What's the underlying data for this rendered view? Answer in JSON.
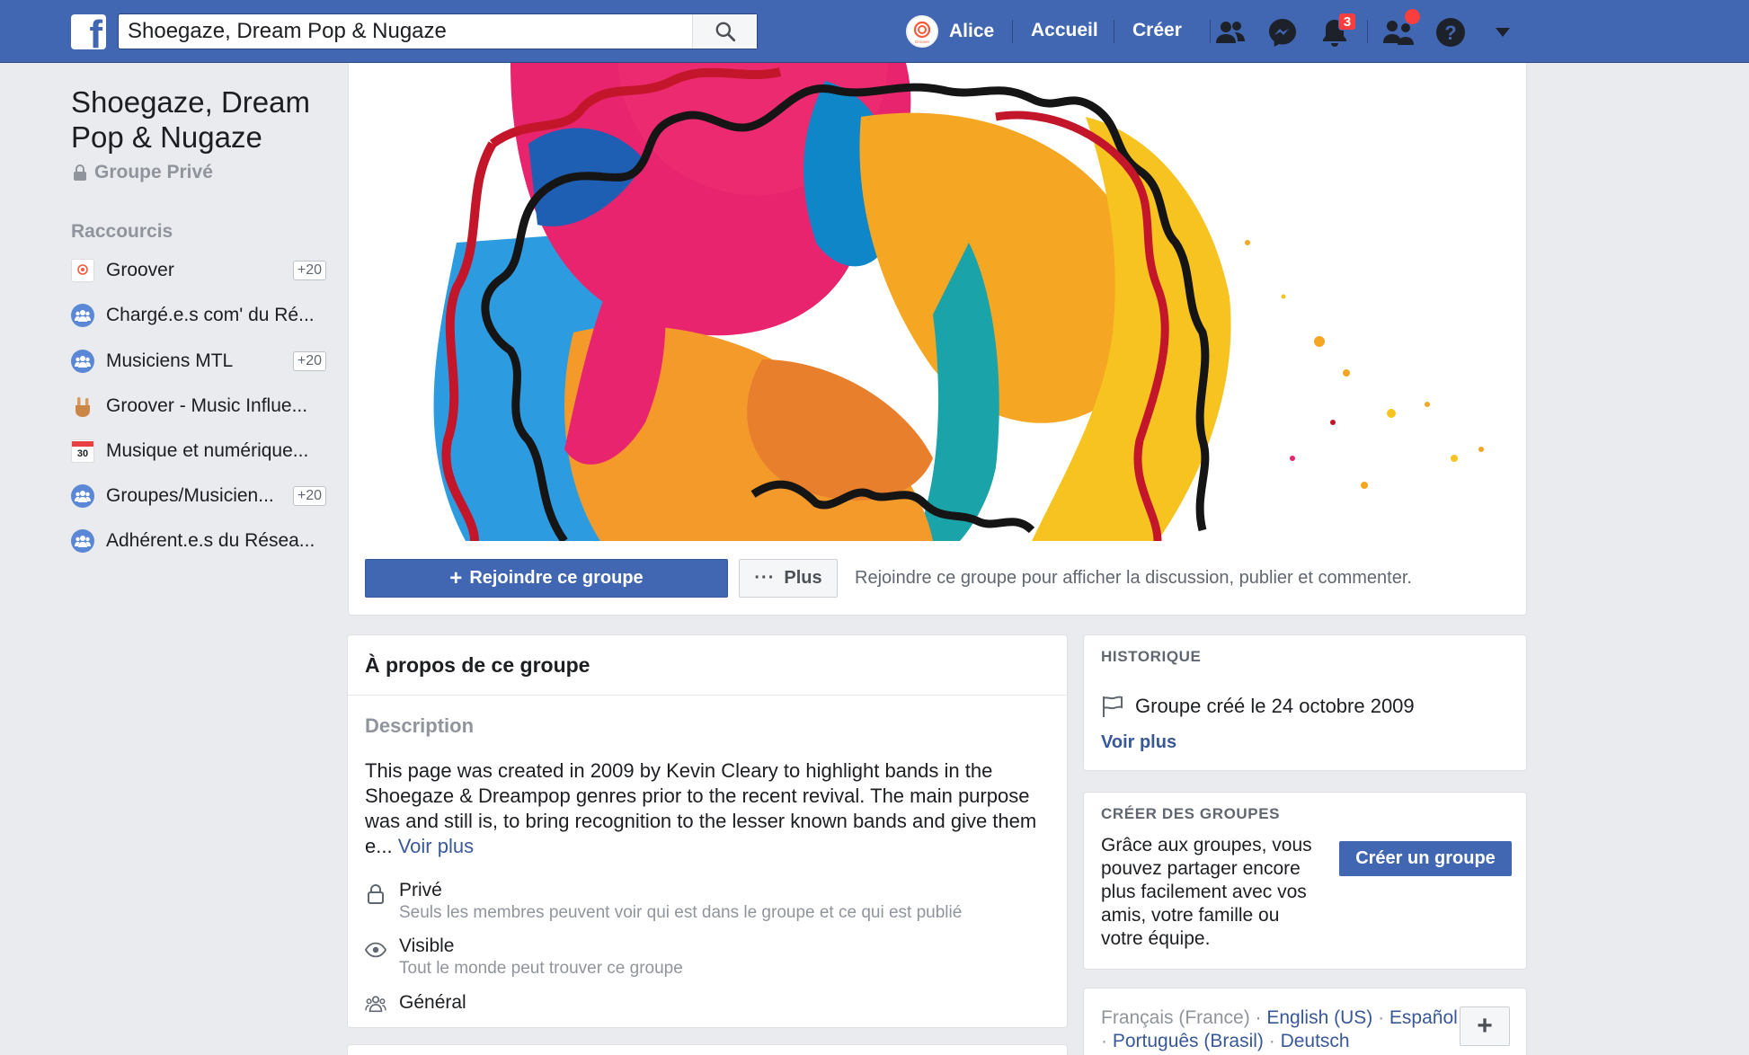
{
  "topbar": {
    "logo": "f",
    "search_value": "Shoegaze, Dream Pop & Nugaze",
    "profile_name": "Alice",
    "avatar_text": "Groover",
    "home_label": "Accueil",
    "create_label": "Créer",
    "notifications_count": "3",
    "icons": [
      "search-icon",
      "friends-icon",
      "messenger-icon",
      "notifications-icon",
      "friend-requests-icon",
      "help-icon",
      "caret-down-icon"
    ]
  },
  "group": {
    "title": "Shoegaze, Dream Pop & Nugaze",
    "privacy": "Groupe Privé"
  },
  "shortcuts": {
    "title": "Raccourcis",
    "items": [
      {
        "label": "Groover",
        "count": "+20",
        "icon": "groover-icon"
      },
      {
        "label": "Chargé.e.s com' du Ré...",
        "count": "",
        "icon": "group-icon"
      },
      {
        "label": "Musiciens MTL",
        "count": "+20",
        "icon": "group-icon"
      },
      {
        "label": "Groover - Music Influe...",
        "count": "",
        "icon": "rock-hand-icon"
      },
      {
        "label": "Musique et numérique...",
        "count": "",
        "icon": "calendar-icon"
      },
      {
        "label": "Groupes/Musicien...",
        "count": "+20",
        "icon": "group-icon"
      },
      {
        "label": "Adhérent.e.s du Résea...",
        "count": "",
        "icon": "group-icon"
      }
    ],
    "calendar_day": "30"
  },
  "cover": {
    "join_label": "Rejoindre ce groupe",
    "more_label": "Plus",
    "join_hint": "Rejoindre ce groupe pour afficher la discussion, publier et commenter."
  },
  "about": {
    "title": "À propos de ce groupe",
    "description_title": "Description",
    "description": "This page was created in 2009 by Kevin Cleary to highlight bands in the Shoegaze & Dreampop genres prior to the recent revival. The main purpose was and still is, to bring recognition to the lesser known bands and give them e...",
    "see_more": "Voir plus",
    "private_title": "Privé",
    "private_sub": "Seuls les membres peuvent voir qui est dans le groupe et ce qui est publié",
    "visible_title": "Visible",
    "visible_sub": "Tout le monde peut trouver ce groupe",
    "general": "Général"
  },
  "history": {
    "label": "HISTORIQUE",
    "created": "Groupe créé le 24 octobre 2009",
    "see_more": "Voir plus"
  },
  "create_groups": {
    "label": "CRÉER DES GROUPES",
    "text": "Grâce aux groupes, vous pouvez partager encore plus facilement avec vos amis, votre famille ou votre équipe.",
    "button": "Créer un groupe"
  },
  "languages": {
    "current": "Français (France)",
    "others": [
      "English (US)",
      "Español",
      "Português (Brasil)",
      "Deutsch"
    ],
    "sep": " · ",
    "add": "+"
  },
  "colors": {
    "brand": "#4267b2",
    "link": "#385898",
    "badge": "#fa3e3e"
  }
}
